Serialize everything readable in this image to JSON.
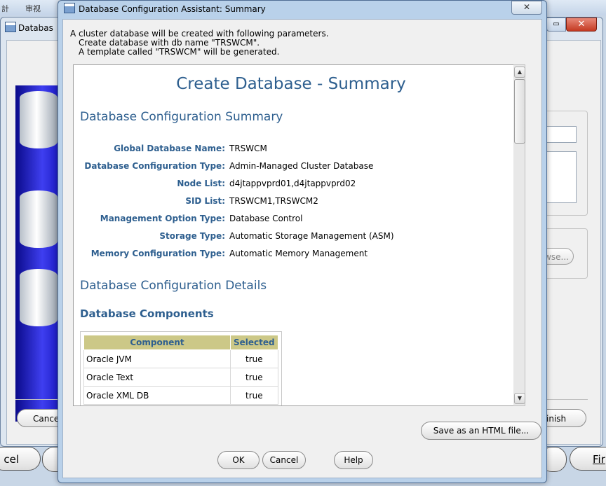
{
  "background": {
    "top_glyphs": [
      "計",
      "审视"
    ],
    "window_title": "Databas",
    "buttons": {
      "cancel": "Cance",
      "finish": "inish",
      "browse": "wse...",
      "cancel_large": "cel",
      "finish_large": "Fir"
    }
  },
  "dialog": {
    "title": "Database Configuration Assistant: Summary",
    "intro": [
      "A cluster database will be created with following parameters.",
      "Create database with db name \"TRSWCM\".",
      "A template called \"TRSWCM\" will be generated."
    ],
    "summary": {
      "title": "Create Database - Summary",
      "section1": "Database Configuration Summary",
      "fields": [
        {
          "label": "Global Database Name:",
          "value": "TRSWCM"
        },
        {
          "label": "Database Configuration Type:",
          "value": "Admin-Managed Cluster Database"
        },
        {
          "label": "Node List:",
          "value": "d4jtappvprd01,d4jtappvprd02"
        },
        {
          "label": "SID List:",
          "value": "TRSWCM1,TRSWCM2"
        },
        {
          "label": "Management Option Type:",
          "value": "Database Control"
        },
        {
          "label": "Storage Type:",
          "value": "Automatic Storage Management (ASM)"
        },
        {
          "label": "Memory Configuration Type:",
          "value": "Automatic Memory Management"
        }
      ],
      "section2": "Database Configuration Details",
      "section3": "Database Components",
      "components": {
        "headers": [
          "Component",
          "Selected"
        ],
        "rows": [
          [
            "Oracle JVM",
            "true"
          ],
          [
            "Oracle Text",
            "true"
          ],
          [
            "Oracle XML DB",
            "true"
          ]
        ]
      }
    },
    "buttons": {
      "save_html": "Save as an HTML file...",
      "ok": "OK",
      "cancel": "Cancel",
      "help": "Help"
    },
    "close_glyph": "✕"
  }
}
